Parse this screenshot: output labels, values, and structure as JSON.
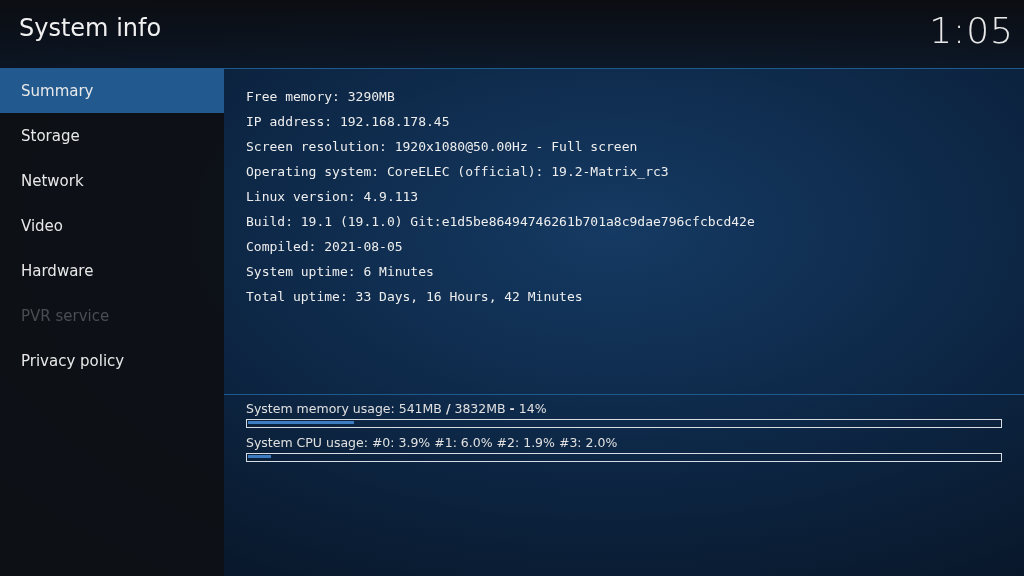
{
  "window": {
    "title": "System info",
    "clock": "1:05"
  },
  "sidebar": {
    "items": [
      {
        "label": "Summary",
        "selected": true,
        "disabled": false
      },
      {
        "label": "Storage",
        "selected": false,
        "disabled": false
      },
      {
        "label": "Network",
        "selected": false,
        "disabled": false
      },
      {
        "label": "Video",
        "selected": false,
        "disabled": false
      },
      {
        "label": "Hardware",
        "selected": false,
        "disabled": false
      },
      {
        "label": "PVR service",
        "selected": false,
        "disabled": true
      },
      {
        "label": "Privacy policy",
        "selected": false,
        "disabled": false
      }
    ]
  },
  "info_lines": [
    "Free memory: 3290MB",
    "IP address: 192.168.178.45",
    "Screen resolution: 1920x1080@50.00Hz - Full screen",
    "Operating system: CoreELEC (official): 19.2-Matrix_rc3",
    "Linux version: 4.9.113",
    "Build: 19.1 (19.1.0) Git:e1d5be86494746261b701a8c9dae796cfcbcd42e",
    "Compiled: 2021-08-05",
    "System uptime: 6 Minutes",
    "Total uptime: 33 Days, 16 Hours, 42 Minutes"
  ],
  "usage_meters": [
    {
      "label": "System memory usage: 541MB **/** 3832MB **-** 14%",
      "level": 0.14
    },
    {
      "label": "System CPU usage: #0: 3.9% #1: 6.0% #2: 1.9% #3: 2.0%",
      "level": 0.03
    }
  ]
}
